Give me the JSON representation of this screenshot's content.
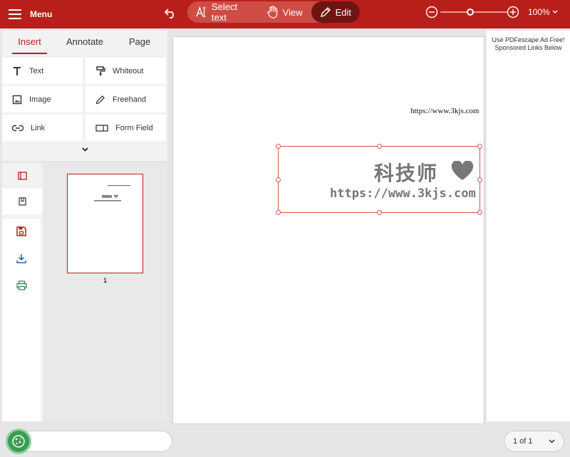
{
  "topbar": {
    "menu_label": "Menu",
    "modes": [
      {
        "label": "Select text",
        "icon": "select-text-icon"
      },
      {
        "label": "View",
        "icon": "hand-icon"
      },
      {
        "label": "Edit",
        "icon": "pencil-icon",
        "active": true
      }
    ],
    "zoom": {
      "level": "100%",
      "slider_fraction": 0.45
    },
    "accent_color": "#b91f1a"
  },
  "panel": {
    "tabs": [
      {
        "label": "Insert",
        "active": true
      },
      {
        "label": "Annotate"
      },
      {
        "label": "Page"
      }
    ],
    "tools": [
      {
        "label": "Text",
        "icon": "text-icon"
      },
      {
        "label": "Whiteout",
        "icon": "paint-roller-icon"
      },
      {
        "label": "Image",
        "icon": "image-icon"
      },
      {
        "label": "Freehand",
        "icon": "pen-icon"
      },
      {
        "label": "Link",
        "icon": "link-icon"
      },
      {
        "label": "Form Field",
        "icon": "form-field-icon"
      }
    ]
  },
  "sidebar": {
    "thumbnail_page_number": "1",
    "buttons": [
      "thumbnails-icon",
      "bookmark-icon",
      "save-icon",
      "download-icon",
      "print-icon"
    ]
  },
  "document": {
    "header_url": "https://www.3kjs.com",
    "logo_text": "科技师",
    "logo_url": "https://www.3kjs.com"
  },
  "ad": {
    "line1": "Use PDFescape Ad Free!",
    "line2": "Sponsored Links Below"
  },
  "footer": {
    "page_indicator": "1 of 1"
  }
}
